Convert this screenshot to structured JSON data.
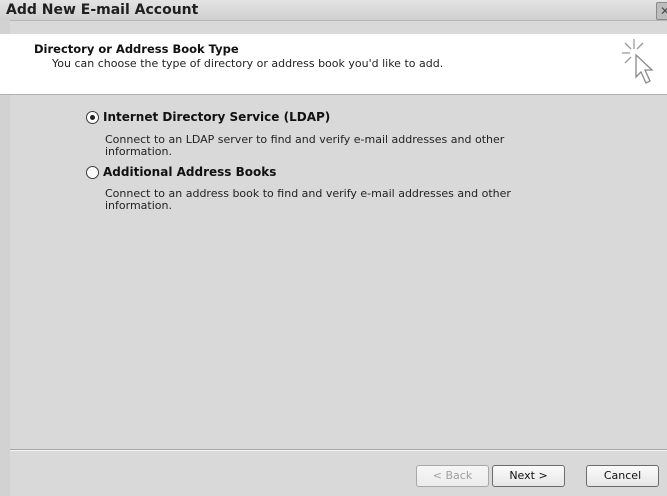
{
  "window": {
    "title": "Add New E-mail Account",
    "close_glyph": "✕"
  },
  "header": {
    "title": "Directory or Address Book Type",
    "subtitle": "You can choose the type of directory or address book you'd like to add.",
    "icon": "wizard-cursor-icon"
  },
  "options": [
    {
      "label": "Internet Directory Service (LDAP)",
      "description": "Connect to an LDAP server to find and verify e-mail addresses and other information.",
      "selected": true
    },
    {
      "label": "Additional Address Books",
      "description": "Connect to an address book to find and verify e-mail addresses and other information.",
      "selected": false
    }
  ],
  "buttons": {
    "back_label": "< Back",
    "next_label": "Next >",
    "cancel_label": "Cancel"
  }
}
